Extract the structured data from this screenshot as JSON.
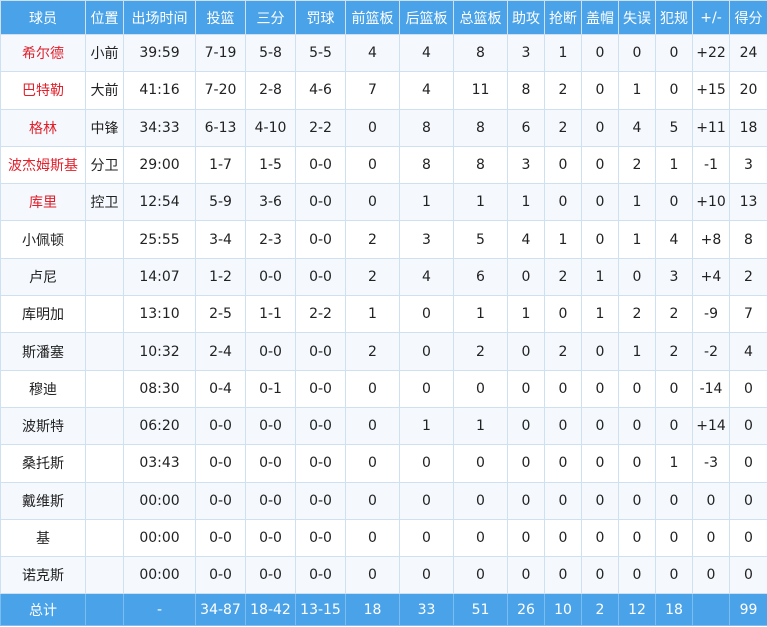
{
  "headers": [
    "球员",
    "位置",
    "出场时间",
    "投篮",
    "三分",
    "罚球",
    "前篮板",
    "后篮板",
    "总篮板",
    "助攻",
    "抢断",
    "盖帽",
    "失误",
    "犯规",
    "+/-",
    "得分"
  ],
  "rows": [
    {
      "player": "希尔德",
      "pos": "小前",
      "min": "39:59",
      "fg": "7-19",
      "tp": "5-8",
      "ft": "5-5",
      "oreb": "4",
      "dreb": "4",
      "reb": "8",
      "ast": "3",
      "stl": "1",
      "blk": "0",
      "tov": "0",
      "pf": "0",
      "pm": "+22",
      "pts": "24"
    },
    {
      "player": "巴特勒",
      "pos": "大前",
      "min": "41:16",
      "fg": "7-20",
      "tp": "2-8",
      "ft": "4-6",
      "oreb": "7",
      "dreb": "4",
      "reb": "11",
      "ast": "8",
      "stl": "2",
      "blk": "0",
      "tov": "1",
      "pf": "0",
      "pm": "+15",
      "pts": "20"
    },
    {
      "player": "格林",
      "pos": "中锋",
      "min": "34:33",
      "fg": "6-13",
      "tp": "4-10",
      "ft": "2-2",
      "oreb": "0",
      "dreb": "8",
      "reb": "8",
      "ast": "6",
      "stl": "2",
      "blk": "0",
      "tov": "4",
      "pf": "5",
      "pm": "+11",
      "pts": "18"
    },
    {
      "player": "波杰姆斯基",
      "pos": "分卫",
      "min": "29:00",
      "fg": "1-7",
      "tp": "1-5",
      "ft": "0-0",
      "oreb": "0",
      "dreb": "8",
      "reb": "8",
      "ast": "3",
      "stl": "0",
      "blk": "0",
      "tov": "2",
      "pf": "1",
      "pm": "-1",
      "pts": "3"
    },
    {
      "player": "库里",
      "pos": "控卫",
      "min": "12:54",
      "fg": "5-9",
      "tp": "3-6",
      "ft": "0-0",
      "oreb": "0",
      "dreb": "1",
      "reb": "1",
      "ast": "1",
      "stl": "0",
      "blk": "0",
      "tov": "1",
      "pf": "0",
      "pm": "+10",
      "pts": "13"
    },
    {
      "player": "小佩顿",
      "pos": "",
      "min": "25:55",
      "fg": "3-4",
      "tp": "2-3",
      "ft": "0-0",
      "oreb": "2",
      "dreb": "3",
      "reb": "5",
      "ast": "4",
      "stl": "1",
      "blk": "0",
      "tov": "1",
      "pf": "4",
      "pm": "+8",
      "pts": "8"
    },
    {
      "player": "卢尼",
      "pos": "",
      "min": "14:07",
      "fg": "1-2",
      "tp": "0-0",
      "ft": "0-0",
      "oreb": "2",
      "dreb": "4",
      "reb": "6",
      "ast": "0",
      "stl": "2",
      "blk": "1",
      "tov": "0",
      "pf": "3",
      "pm": "+4",
      "pts": "2"
    },
    {
      "player": "库明加",
      "pos": "",
      "min": "13:10",
      "fg": "2-5",
      "tp": "1-1",
      "ft": "2-2",
      "oreb": "1",
      "dreb": "0",
      "reb": "1",
      "ast": "1",
      "stl": "0",
      "blk": "1",
      "tov": "2",
      "pf": "2",
      "pm": "-9",
      "pts": "7"
    },
    {
      "player": "斯潘塞",
      "pos": "",
      "min": "10:32",
      "fg": "2-4",
      "tp": "0-0",
      "ft": "0-0",
      "oreb": "2",
      "dreb": "0",
      "reb": "2",
      "ast": "0",
      "stl": "2",
      "blk": "0",
      "tov": "1",
      "pf": "2",
      "pm": "-2",
      "pts": "4"
    },
    {
      "player": "穆迪",
      "pos": "",
      "min": "08:30",
      "fg": "0-4",
      "tp": "0-1",
      "ft": "0-0",
      "oreb": "0",
      "dreb": "0",
      "reb": "0",
      "ast": "0",
      "stl": "0",
      "blk": "0",
      "tov": "0",
      "pf": "0",
      "pm": "-14",
      "pts": "0"
    },
    {
      "player": "波斯特",
      "pos": "",
      "min": "06:20",
      "fg": "0-0",
      "tp": "0-0",
      "ft": "0-0",
      "oreb": "0",
      "dreb": "1",
      "reb": "1",
      "ast": "0",
      "stl": "0",
      "blk": "0",
      "tov": "0",
      "pf": "0",
      "pm": "+14",
      "pts": "0"
    },
    {
      "player": "桑托斯",
      "pos": "",
      "min": "03:43",
      "fg": "0-0",
      "tp": "0-0",
      "ft": "0-0",
      "oreb": "0",
      "dreb": "0",
      "reb": "0",
      "ast": "0",
      "stl": "0",
      "blk": "0",
      "tov": "0",
      "pf": "1",
      "pm": "-3",
      "pts": "0"
    },
    {
      "player": "戴维斯",
      "pos": "",
      "min": "00:00",
      "fg": "0-0",
      "tp": "0-0",
      "ft": "0-0",
      "oreb": "0",
      "dreb": "0",
      "reb": "0",
      "ast": "0",
      "stl": "0",
      "blk": "0",
      "tov": "0",
      "pf": "0",
      "pm": "0",
      "pts": "0"
    },
    {
      "player": "基",
      "pos": "",
      "min": "00:00",
      "fg": "0-0",
      "tp": "0-0",
      "ft": "0-0",
      "oreb": "0",
      "dreb": "0",
      "reb": "0",
      "ast": "0",
      "stl": "0",
      "blk": "0",
      "tov": "0",
      "pf": "0",
      "pm": "0",
      "pts": "0"
    },
    {
      "player": "诺克斯",
      "pos": "",
      "min": "00:00",
      "fg": "0-0",
      "tp": "0-0",
      "ft": "0-0",
      "oreb": "0",
      "dreb": "0",
      "reb": "0",
      "ast": "0",
      "stl": "0",
      "blk": "0",
      "tov": "0",
      "pf": "0",
      "pm": "0",
      "pts": "0"
    }
  ],
  "total": {
    "player": "总计",
    "pos": "",
    "min": "-",
    "fg": "34-87",
    "tp": "18-42",
    "ft": "13-15",
    "oreb": "18",
    "dreb": "33",
    "reb": "51",
    "ast": "26",
    "stl": "10",
    "blk": "2",
    "tov": "12",
    "pf": "18",
    "pm": "",
    "pts": "99"
  },
  "starter_count": 5,
  "colors": {
    "header_bg": "#4aa3e8",
    "starter_text": "#e0202b",
    "grid": "#cfe0f0"
  }
}
